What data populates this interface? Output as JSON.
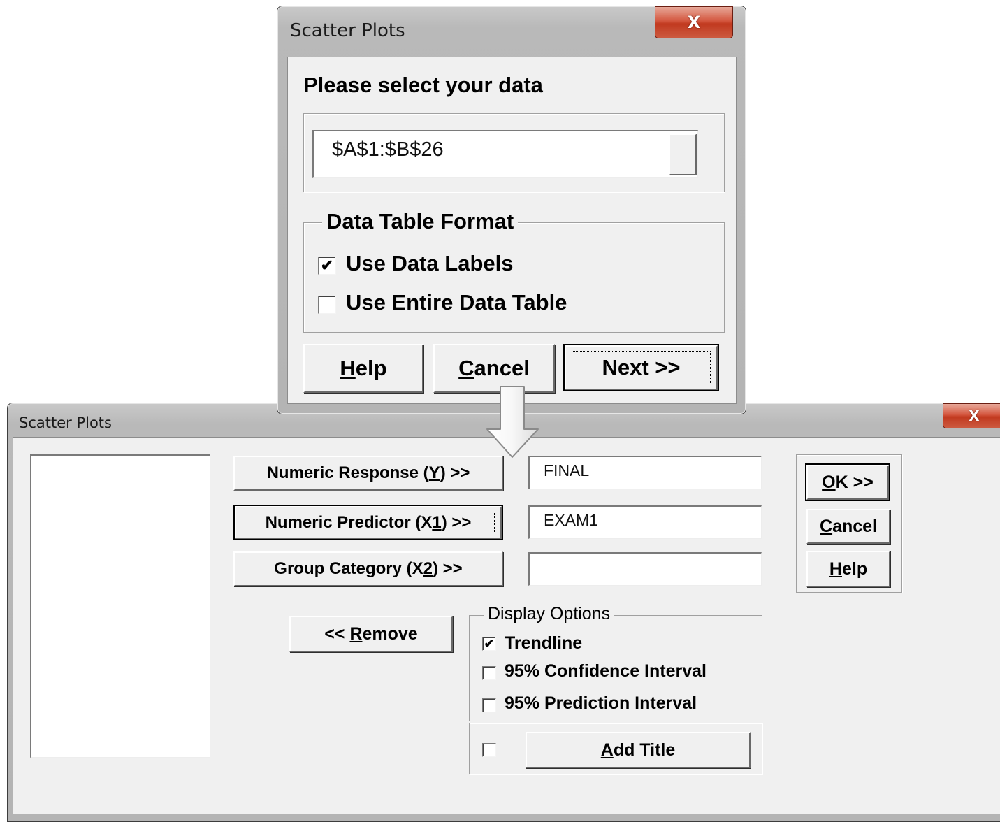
{
  "dialog1": {
    "title": "Scatter Plots",
    "close_glyph": "X",
    "prompt": "Please select your data",
    "range_value": "$A$1:$B$26",
    "collapse_glyph": "_",
    "format_group": {
      "label": "Data Table Format",
      "use_labels": {
        "label": "Use Data Labels",
        "checked": true
      },
      "use_entire": {
        "label": "Use Entire Data Table",
        "checked": false
      }
    },
    "buttons": {
      "help": {
        "mnemonic": "H",
        "rest": "elp"
      },
      "cancel": {
        "mnemonic": "C",
        "rest": "ancel"
      },
      "next": "Next >>"
    }
  },
  "dialog2": {
    "title": "Scatter Plots",
    "close_glyph": "X",
    "variables": {
      "response": {
        "pre": "Numeric Response (",
        "mnemonic": "Y",
        "post": ") >>",
        "value": "FINAL"
      },
      "predictor": {
        "pre": "Numeric Predictor (X",
        "mnemonic": "1",
        "post": ") >>",
        "value": "EXAM1"
      },
      "group": {
        "pre": "Group Category (X",
        "mnemonic": "2",
        "post": ") >>",
        "value": ""
      }
    },
    "remove": {
      "pre": "<< ",
      "mnemonic": "R",
      "rest": "emove"
    },
    "side_buttons": {
      "ok": {
        "mnemonic": "O",
        "rest": "K >>"
      },
      "cancel": {
        "mnemonic": "C",
        "rest": "ancel"
      },
      "help": {
        "mnemonic": "H",
        "rest": "elp"
      }
    },
    "display_options": {
      "label": "Display Options",
      "trendline": {
        "label": "Trendline",
        "checked": true
      },
      "confidence": {
        "label": "95% Confidence Interval",
        "checked": false
      },
      "prediction": {
        "label": "95% Prediction Interval",
        "checked": false
      }
    },
    "add_title": {
      "checked": false,
      "mnemonic": "A",
      "rest": "dd Title"
    }
  },
  "colors": {
    "close_button": "#c1391f",
    "dialog_face": "#f0f0f0",
    "title_bar": "#c2c2c2"
  },
  "icons": {
    "arrow": "down-arrow-icon"
  }
}
